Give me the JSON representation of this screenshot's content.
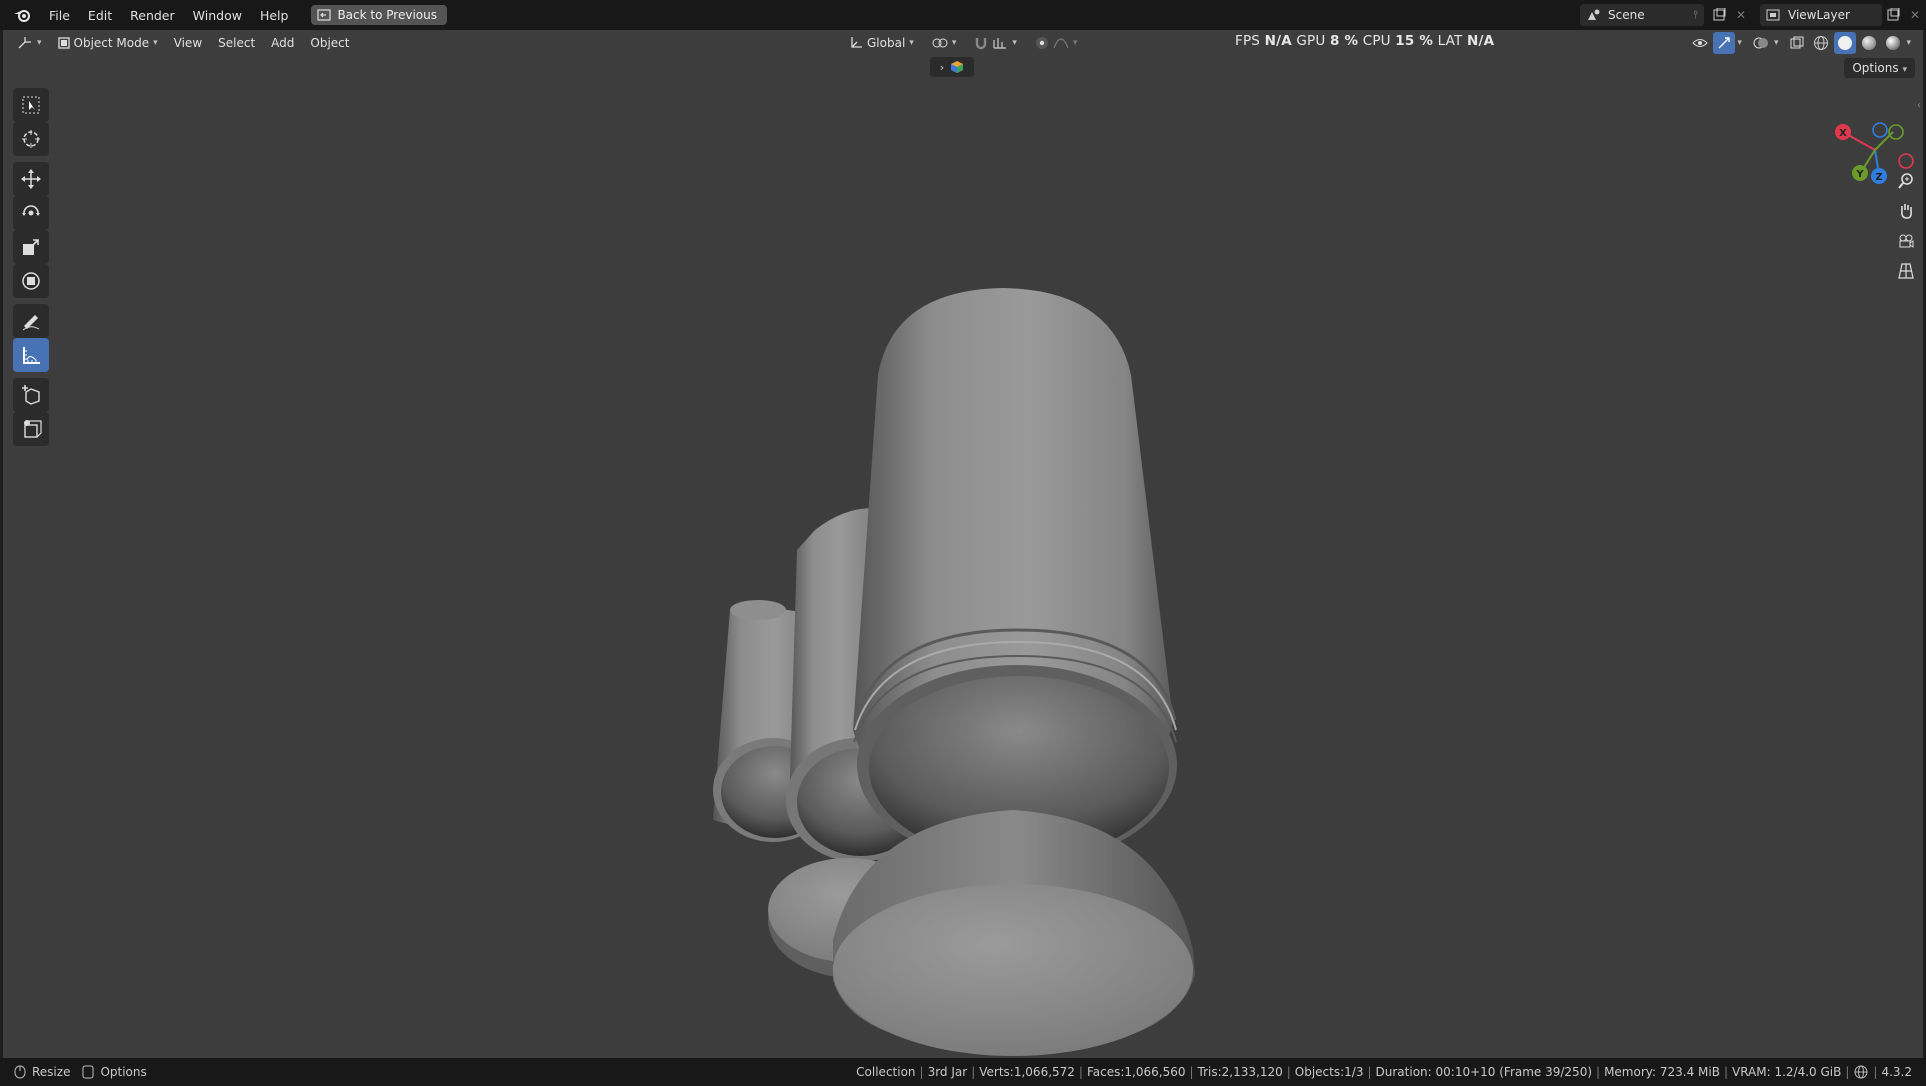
{
  "menu": {
    "items": [
      "File",
      "Edit",
      "Render",
      "Window",
      "Help"
    ],
    "back_button": "Back to Previous"
  },
  "scene": {
    "label": "Scene"
  },
  "view_layer": {
    "label": "ViewLayer"
  },
  "viewport_header": {
    "mode": "Object Mode",
    "menus": [
      "View",
      "Select",
      "Add",
      "Object"
    ],
    "orientation": "Global",
    "options": "Options"
  },
  "perf": {
    "fps_label": "FPS",
    "fps_value": "N/A",
    "gpu_label": "GPU",
    "gpu_value": "8 %",
    "cpu_label": "CPU",
    "cpu_value": "15 %",
    "lat_label": "LAT",
    "lat_value": "N/A"
  },
  "gizmo": {
    "x": "X",
    "y": "Y",
    "z": "Z"
  },
  "status": {
    "left": [
      "Resize",
      "Options"
    ],
    "collection": "Collection",
    "object": "3rd Jar",
    "verts": "Verts:1,066,572",
    "faces": "Faces:1,066,560",
    "tris": "Tris:2,133,120",
    "objects": "Objects:1/3",
    "duration": "Duration: 00:10+10 (Frame 39/250)",
    "memory": "Memory: 723.4 MiB",
    "vram": "VRAM: 1.2/4.0 GiB",
    "version": "4.3.2"
  },
  "colors": {
    "viewport_bg": "#3d3d3d",
    "active_tool": "#4772b3",
    "axis_x": "#e0394f",
    "axis_y": "#6b9c2a",
    "axis_z": "#2f7fe0"
  }
}
